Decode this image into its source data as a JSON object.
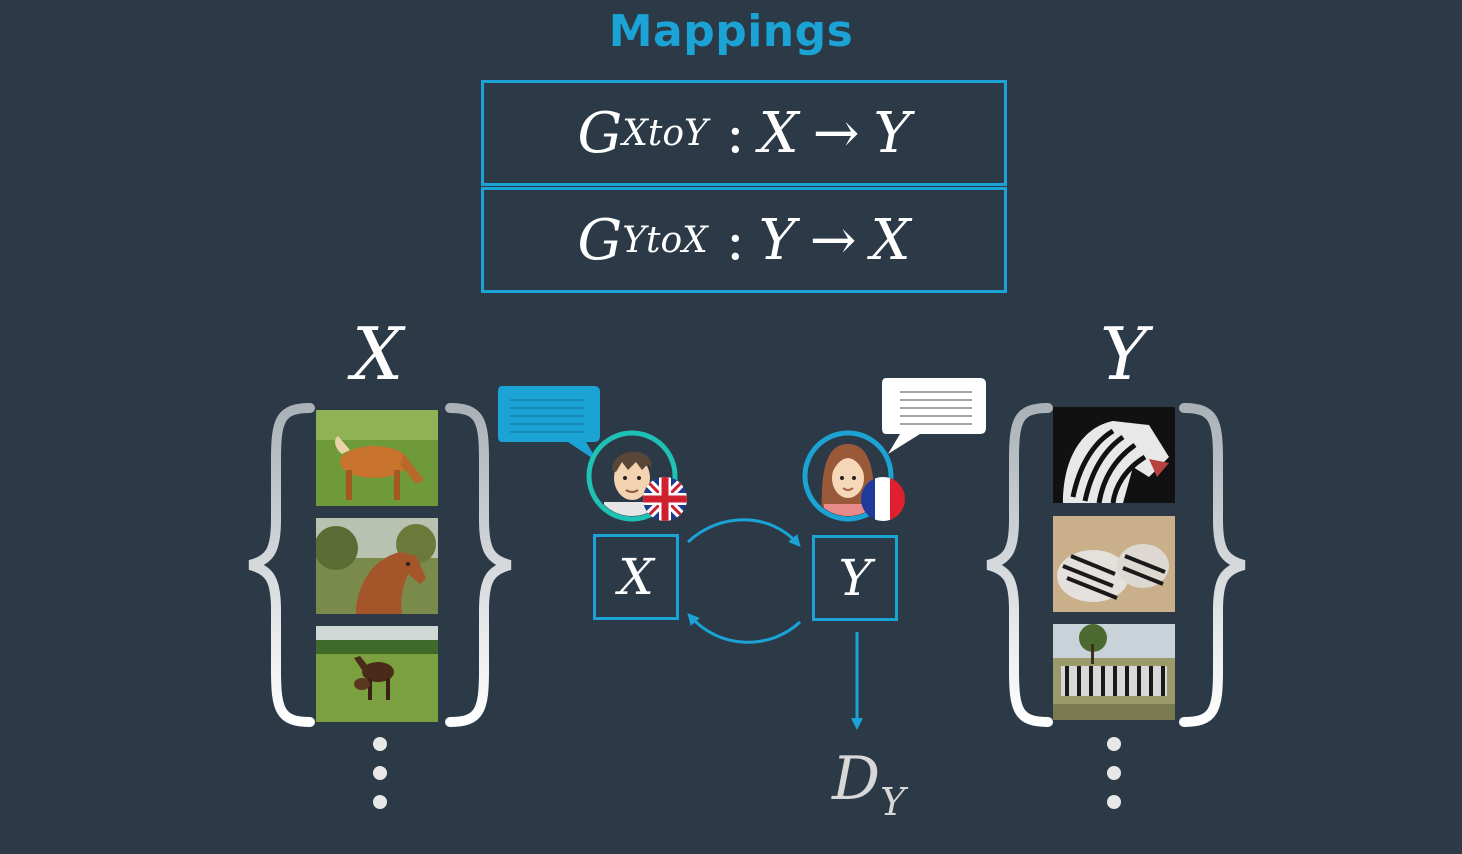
{
  "title": "Mappings",
  "mappings": [
    {
      "name": "G",
      "subscript": "XtoY",
      "domain": "X",
      "arrow": "→",
      "codomain": "Y",
      "separator": ":"
    },
    {
      "name": "G",
      "subscript": "YtoX",
      "domain": "Y",
      "arrow": "→",
      "codomain": "X",
      "separator": ":"
    }
  ],
  "sets": {
    "left": {
      "label": "X",
      "images": [
        "horse-photo",
        "horse-photo",
        "horse-photo"
      ]
    },
    "right": {
      "label": "Y",
      "images": [
        "zebra-photo",
        "zebra-photo",
        "zebra-photo"
      ]
    }
  },
  "nodes": {
    "x": "X",
    "y": "Y"
  },
  "discriminator": {
    "name": "D",
    "subscript": "Y"
  },
  "colors": {
    "accent": "#1ba3d6",
    "background": "#2b3a46",
    "avatar_ring": "#1ec1b4"
  },
  "icons": [
    "speech-bubble-icon",
    "boy-avatar-icon",
    "uk-flag-icon",
    "girl-avatar-icon",
    "france-flag-icon",
    "curly-brace-icon"
  ]
}
